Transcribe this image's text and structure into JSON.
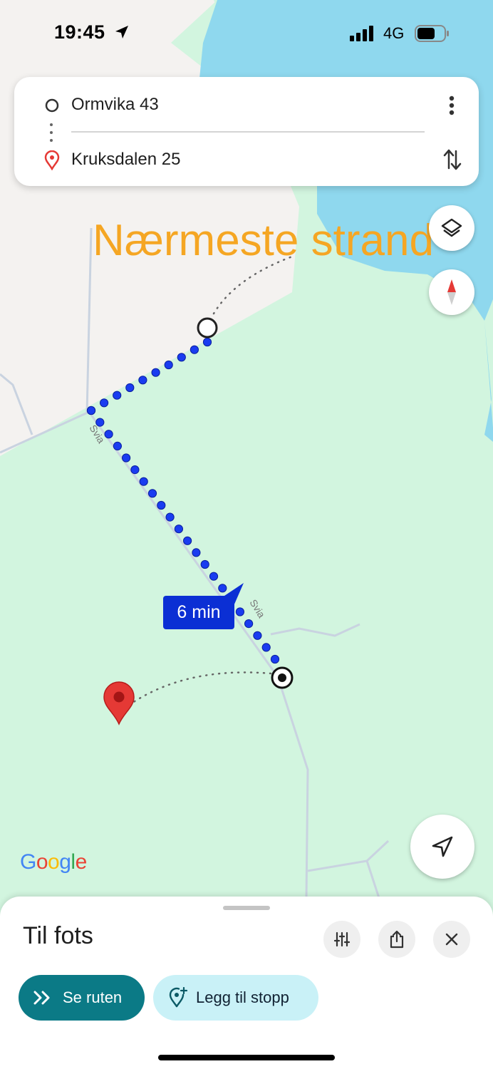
{
  "status_bar": {
    "time": "19:45",
    "network": "4G"
  },
  "route": {
    "origin": "Ormvika 43",
    "destination": "Kruksdalen 25"
  },
  "overlay_text": "Nærmeste strand",
  "map": {
    "road_labels": [
      "Svia",
      "Svia"
    ],
    "duration_badge": "6 min",
    "attribution": "Google"
  },
  "sheet": {
    "mode": "Til fots",
    "primary_button": "Se ruten",
    "secondary_button": "Legg til stopp"
  },
  "colors": {
    "water": "#8fd8ee",
    "park": "#d2f5df",
    "land": "#f4f2f0",
    "route": "#1a3cf0",
    "overlay": "#f5a623",
    "primary_button": "#0b7a86",
    "secondary_button": "#c9f1f7"
  },
  "icons": [
    "navigation-arrow-icon",
    "more-vert-icon",
    "swap-icon",
    "layers-icon",
    "compass-icon",
    "my-location-icon",
    "filter-icon",
    "share-icon",
    "close-icon",
    "chevrons-icon",
    "add-stop-icon",
    "destination-pin-icon"
  ]
}
